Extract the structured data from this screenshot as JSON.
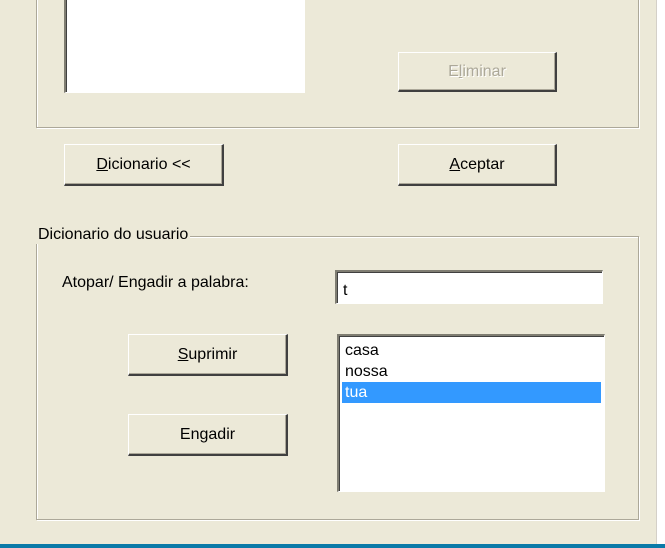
{
  "top_section": {
    "eliminar_label": "Eliminar",
    "eliminar_mnemonic": "l"
  },
  "actions": {
    "dicionario_label": "Dicionario <<",
    "dicionario_mnemonic": "D",
    "aceptar_label": "Aceptar",
    "aceptar_mnemonic": "A"
  },
  "user_dictionary": {
    "group_title": "Dicionario do usuario",
    "find_add_label": "Atopar/ Engadir a palabra:",
    "word_input_value": "t",
    "suprimir_label": "Suprimir",
    "suprimir_mnemonic": "S",
    "engadir_label": "Engadir",
    "words": [
      {
        "text": "casa",
        "selected": false
      },
      {
        "text": "nossa",
        "selected": false
      },
      {
        "text": "tua",
        "selected": true
      }
    ]
  },
  "colors": {
    "dialog_background": "#ece9d8",
    "selection_highlight": "#3399ff",
    "taskbar_strip": "#0a7aa8",
    "disabled_text": "#aca899"
  }
}
